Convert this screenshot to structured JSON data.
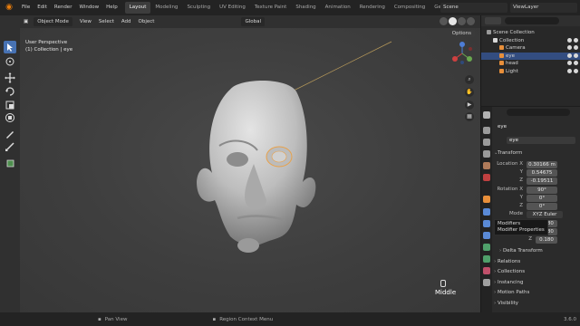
{
  "topbar": {
    "menus": [
      "File",
      "Edit",
      "Render",
      "Window",
      "Help"
    ],
    "workspaces": [
      "Layout",
      "Modeling",
      "Sculpting",
      "UV Editing",
      "Texture Paint",
      "Shading",
      "Animation",
      "Rendering",
      "Compositing",
      "Geometry Nodes",
      "Scripting"
    ],
    "active_workspace": "Layout",
    "scene": "Scene",
    "view_layer": "ViewLayer"
  },
  "viewport_header": {
    "mode": "Object Mode",
    "menus": [
      "View",
      "Select",
      "Add",
      "Object"
    ],
    "orientation": "Global"
  },
  "viewport": {
    "view_name": "User Perspective",
    "collection_info": "(1) Collection | eye",
    "options_label": "Options",
    "mouse_hint": "Middle"
  },
  "outliner": {
    "rows": [
      {
        "label": "Scene Collection",
        "indent": 0,
        "selected": false,
        "icon_color": "#9a9a9a"
      },
      {
        "label": "Collection",
        "indent": 1,
        "selected": false,
        "icon_color": "#d8d8d8"
      },
      {
        "label": "Camera",
        "indent": 2,
        "selected": false,
        "icon_color": "#e88f3a"
      },
      {
        "label": "eye",
        "indent": 2,
        "selected": true,
        "icon_color": "#e88f3a"
      },
      {
        "label": "head",
        "indent": 2,
        "selected": false,
        "icon_color": "#e88f3a"
      },
      {
        "label": "Light",
        "indent": 2,
        "selected": false,
        "icon_color": "#e88f3a"
      }
    ]
  },
  "properties": {
    "object_name": "eye",
    "datablock_name": "eye",
    "transform_label": "Transform",
    "location_label": "Location X",
    "location": {
      "x": "0.30166 m",
      "y": "0.54675",
      "z": "-0.19511"
    },
    "rotation_label": "Rotation X",
    "rotation": {
      "x": "90°",
      "y": "0°",
      "z": "0°"
    },
    "mode_label": "Mode",
    "mode_value": "XYZ Euler",
    "scale": {
      "x": "0.180",
      "y": "0.180",
      "z": "0.180"
    },
    "tooltip_title": "Modifiers",
    "tooltip_sub": "Modifier Properties",
    "sections": [
      "Delta Transform",
      "Relations",
      "Collections",
      "Instancing",
      "Motion Paths",
      "Visibility"
    ]
  },
  "statusbar": {
    "left": "Pan View",
    "middle": "Region Context Menu",
    "version": "3.6.0"
  },
  "colors": {
    "accent": "#4772b3",
    "selected_row": "#334d80",
    "object_orange": "#e88f3a"
  }
}
